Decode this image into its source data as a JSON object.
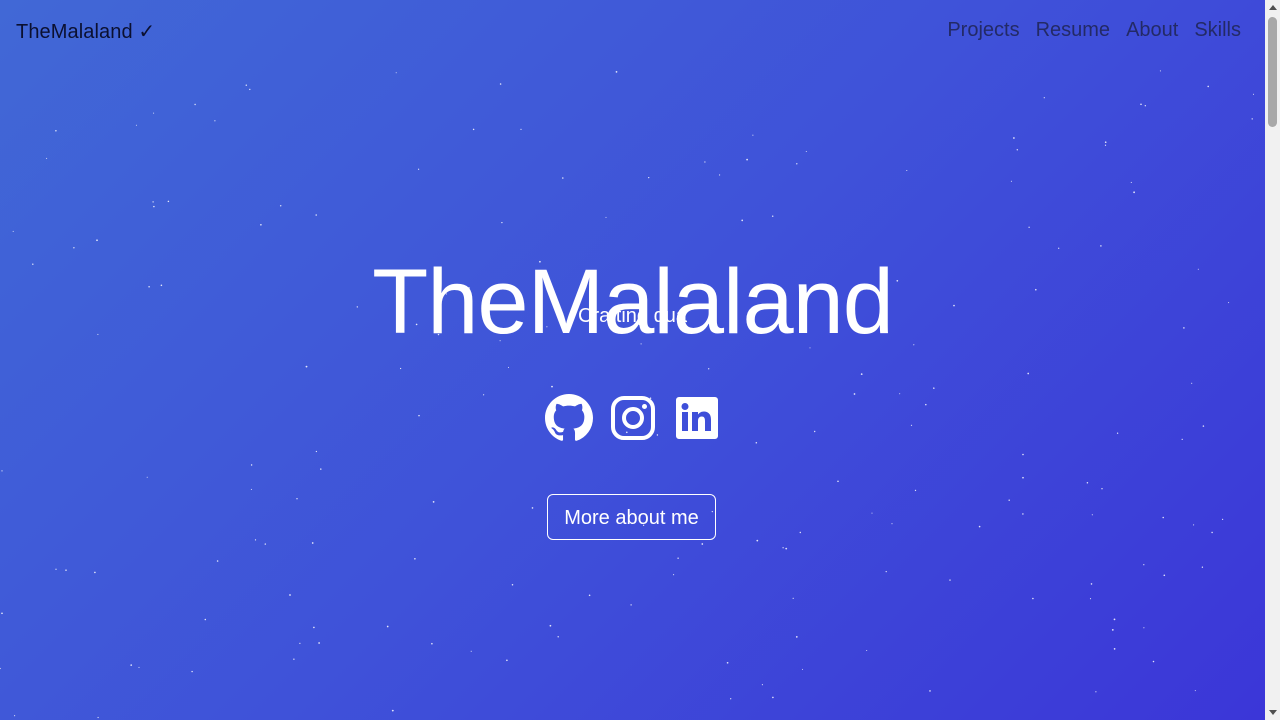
{
  "navbar": {
    "brand": "TheMalaland ✓",
    "links": [
      {
        "label": "Projects"
      },
      {
        "label": "Resume"
      },
      {
        "label": "About"
      },
      {
        "label": "Skills"
      }
    ]
  },
  "hero": {
    "title": "TheMalaland",
    "subtitle": "Crafting qua",
    "social_icons": [
      "github-icon",
      "instagram-icon",
      "linkedin-icon"
    ],
    "cta_label": "More about me"
  },
  "colors": {
    "gradient_start": "#4168d6",
    "gradient_end": "#3b36d8",
    "text": "#ffffff",
    "brand_text": "#0b1030",
    "nav_text": "#232a66"
  }
}
